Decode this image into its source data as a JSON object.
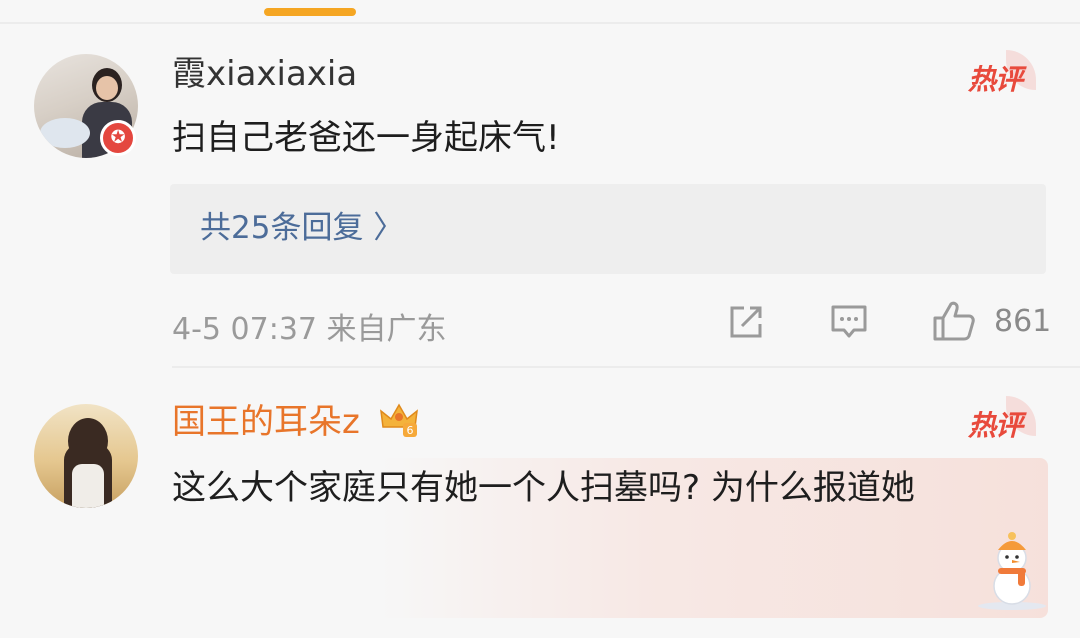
{
  "comments": [
    {
      "username": "霞xiaxiaxia",
      "content": "扫自己老爸还一身起床气!",
      "hot_label": "热评",
      "reply_link": "共25条回复 〉",
      "timestamp": "4-5 07:37 来自广东",
      "likes": "861"
    },
    {
      "username": "国王的耳朵z",
      "content": "这么大个家庭只有她一个人扫墓吗? 为什么报道她",
      "hot_label": "热评"
    }
  ],
  "colors": {
    "accent_orange": "#e8752a",
    "hot_red": "#e84a3c",
    "link_blue": "#4c6c99",
    "meta_gray": "#9a9a9a"
  },
  "icons": [
    "verified-badge-icon",
    "crown-level-icon",
    "share-icon",
    "comment-icon",
    "like-icon",
    "snowman-decoration-icon"
  ]
}
